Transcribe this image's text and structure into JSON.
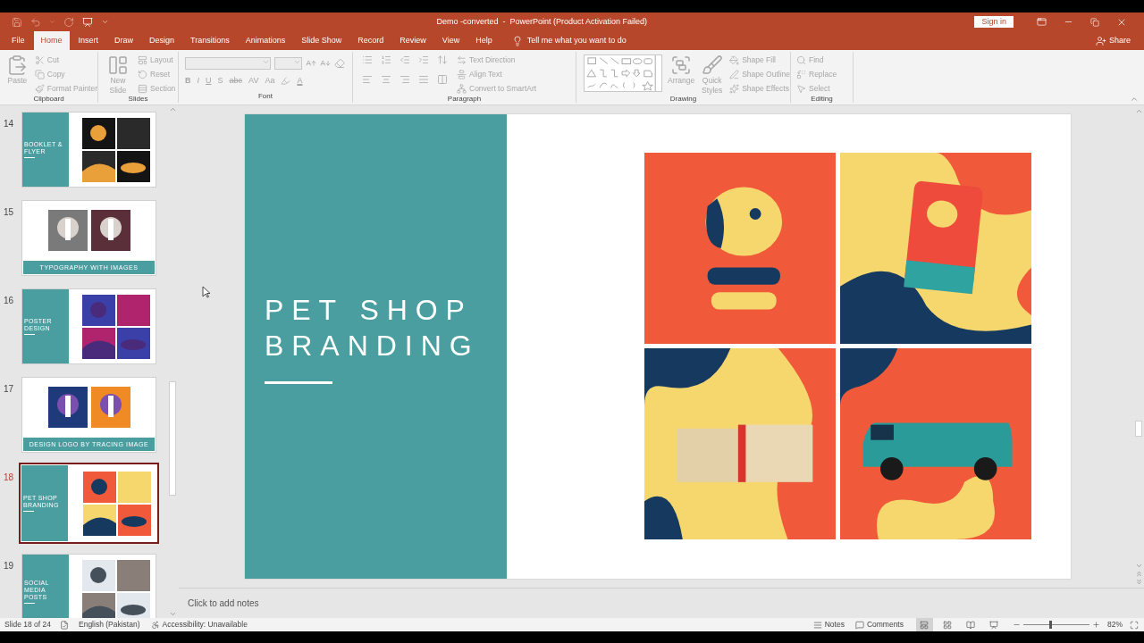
{
  "window": {
    "title": "Demo -converted  -  PowerPoint (Product Activation Failed)",
    "sign_in_button": "Sign in"
  },
  "tabs": [
    {
      "label": "File",
      "selected": false
    },
    {
      "label": "Home",
      "selected": true
    },
    {
      "label": "Insert",
      "selected": false
    },
    {
      "label": "Draw",
      "selected": false
    },
    {
      "label": "Design",
      "selected": false
    },
    {
      "label": "Transitions",
      "selected": false
    },
    {
      "label": "Animations",
      "selected": false
    },
    {
      "label": "Slide Show",
      "selected": false
    },
    {
      "label": "Record",
      "selected": false
    },
    {
      "label": "Review",
      "selected": false
    },
    {
      "label": "View",
      "selected": false
    },
    {
      "label": "Help",
      "selected": false
    }
  ],
  "tell_me": "Tell me what you want to do",
  "share_button": "Share",
  "ribbon": {
    "disabled": true,
    "groups": [
      {
        "kind": "clipboard",
        "name": "Clipboard",
        "large": [
          "Paste"
        ],
        "small": [
          "Cut",
          "Copy",
          "Format Painter"
        ]
      },
      {
        "kind": "slides",
        "name": "Slides",
        "large": [
          "New Slide"
        ],
        "small": [
          "Layout",
          "Reset",
          "Section"
        ]
      },
      {
        "kind": "font",
        "name": "Font",
        "buttons": [
          "B",
          "I",
          "U",
          "S",
          "abc",
          "AV",
          "Aa",
          "A"
        ]
      },
      {
        "kind": "paragraph",
        "name": "Paragraph",
        "small": [
          "Text Direction",
          "Align Text",
          "Convert to SmartArt"
        ]
      },
      {
        "kind": "drawing",
        "name": "Drawing",
        "large": [
          "Arrange",
          "Quick Styles"
        ],
        "small": [
          "Shape Fill",
          "Shape Outline",
          "Shape Effects"
        ]
      },
      {
        "kind": "editing",
        "name": "Editing",
        "small": [
          "Find",
          "Replace",
          "Select"
        ]
      }
    ]
  },
  "slides": [
    {
      "number": "14",
      "title": "BOOKLET & FLYER",
      "kind": "side",
      "selected": false
    },
    {
      "number": "15",
      "title": "TYPOGRAPHY WITH IMAGES",
      "kind": "bottom",
      "selected": false
    },
    {
      "number": "16",
      "title": "POSTER DESIGN",
      "kind": "side",
      "selected": false
    },
    {
      "number": "17",
      "title": "DESIGN LOGO BY TRACING IMAGE",
      "kind": "bottom",
      "selected": false
    },
    {
      "number": "18",
      "title": "PET SHOP BRANDING",
      "kind": "side",
      "selected": true
    },
    {
      "number": "19",
      "title": "SOCIAL MEDIA POSTS",
      "kind": "side",
      "selected": false
    }
  ],
  "slide": {
    "title_lines": [
      "PET SHOP",
      "BRANDING"
    ]
  },
  "notes_placeholder": "Click to add notes",
  "status_bar": {
    "slide_position": "Slide 18 of 24",
    "language": "English (Pakistan)",
    "accessibility": "Accessibility: Unavailable",
    "notes_button": "Notes",
    "comments_button": "Comments",
    "views": [
      {
        "kind": "normal",
        "selected": true
      },
      {
        "kind": "sorter",
        "selected": false
      },
      {
        "kind": "reading",
        "selected": false
      },
      {
        "kind": "slideshow",
        "selected": false
      }
    ],
    "zoom": {
      "level": 0.41,
      "reading": "82%"
    }
  }
}
